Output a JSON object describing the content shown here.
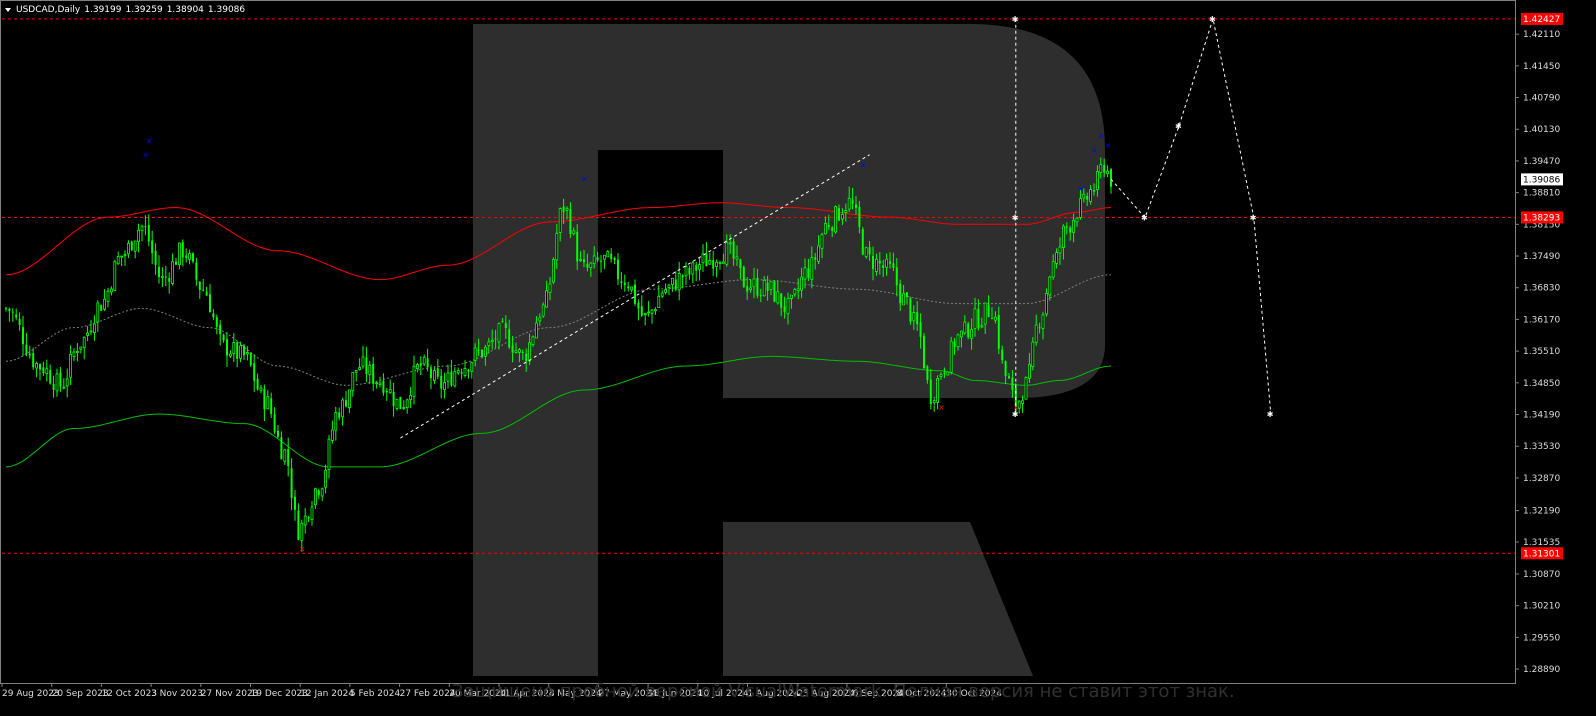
{
  "header": {
    "symbol": "USDCAD,Daily",
    "open": "1.39199",
    "high": "1.39259",
    "low": "1.38904",
    "close": "1.39086"
  },
  "watermark_text": "Защищено пробной версией VisualWatermark. Полная версия не ставит этот знак.",
  "colors": {
    "background": "#000000",
    "candle": "#00ff00",
    "ma_upper": "#ff0000",
    "ma_lower": "#00c000",
    "ma_mid": "#808080",
    "level_line": "#ff0000",
    "forecast": "#ffffff",
    "fractal_up": "#0000ff",
    "fractal_down": "#ff0000",
    "price_tag": "#ff0000",
    "current_tag": "#ffffff",
    "watermark": "#2e2e2e"
  },
  "chart_data": {
    "type": "candlestick",
    "symbol": "USDCAD",
    "timeframe": "Daily",
    "ylim": [
      1.286,
      1.428
    ],
    "price_ticks": [
      "1.42110",
      "1.41450",
      "1.40790",
      "1.40130",
      "1.39470",
      "1.38810",
      "1.38150",
      "1.37490",
      "1.36830",
      "1.36170",
      "1.35510",
      "1.34850",
      "1.34190",
      "1.33530",
      "1.32870",
      "1.32190",
      "1.31535",
      "1.30870",
      "1.30210",
      "1.29550",
      "1.28890"
    ],
    "date_ticks": [
      "29 Aug 2023",
      "20 Sep 2023",
      "12 Oct 2023",
      "3 Nov 2023",
      "27 Nov 2023",
      "19 Dec 2023",
      "12 Jan 2024",
      "5 Feb 2024",
      "27 Feb 2024",
      "20 Mar 2024",
      "11 Apr 2024",
      "3 May 2024",
      "27 May 2024",
      "18 Jun 2024",
      "10 Jul 2024",
      "1 Aug 2024",
      "23 Aug 2024",
      "16 Sep 2024",
      "8 Oct 2024",
      "30 Oct 2024"
    ],
    "price_tags": [
      {
        "label": "1.42427",
        "value": 1.42427,
        "kind": "level"
      },
      {
        "label": "1.39086",
        "value": 1.39086,
        "kind": "current"
      },
      {
        "label": "1.38293",
        "value": 1.38293,
        "kind": "level"
      },
      {
        "label": "1.31301",
        "value": 1.31301,
        "kind": "level"
      }
    ],
    "levels": [
      1.42427,
      1.38293,
      1.31301
    ],
    "close_anchors": [
      [
        0,
        1.364
      ],
      [
        10,
        1.352
      ],
      [
        16,
        1.348
      ],
      [
        22,
        1.357
      ],
      [
        28,
        1.365
      ],
      [
        34,
        1.375
      ],
      [
        40,
        1.381
      ],
      [
        46,
        1.37
      ],
      [
        52,
        1.376
      ],
      [
        58,
        1.368
      ],
      [
        64,
        1.356
      ],
      [
        70,
        1.354
      ],
      [
        76,
        1.345
      ],
      [
        82,
        1.334
      ],
      [
        86,
        1.318
      ],
      [
        92,
        1.327
      ],
      [
        98,
        1.343
      ],
      [
        104,
        1.352
      ],
      [
        110,
        1.349
      ],
      [
        116,
        1.344
      ],
      [
        122,
        1.352
      ],
      [
        128,
        1.348
      ],
      [
        134,
        1.352
      ],
      [
        140,
        1.355
      ],
      [
        146,
        1.359
      ],
      [
        152,
        1.354
      ],
      [
        158,
        1.364
      ],
      [
        164,
        1.385
      ],
      [
        170,
        1.372
      ],
      [
        176,
        1.374
      ],
      [
        182,
        1.37
      ],
      [
        188,
        1.362
      ],
      [
        194,
        1.368
      ],
      [
        200,
        1.371
      ],
      [
        206,
        1.374
      ],
      [
        212,
        1.376
      ],
      [
        218,
        1.369
      ],
      [
        224,
        1.368
      ],
      [
        230,
        1.364
      ],
      [
        236,
        1.372
      ],
      [
        242,
        1.382
      ],
      [
        248,
        1.386
      ],
      [
        254,
        1.374
      ],
      [
        260,
        1.372
      ],
      [
        264,
        1.366
      ],
      [
        268,
        1.36
      ],
      [
        272,
        1.346
      ],
      [
        276,
        1.352
      ],
      [
        280,
        1.358
      ],
      [
        286,
        1.362
      ],
      [
        290,
        1.364
      ],
      [
        294,
        1.35
      ],
      [
        297,
        1.344
      ],
      [
        300,
        1.348
      ],
      [
        304,
        1.362
      ],
      [
        308,
        1.373
      ],
      [
        312,
        1.381
      ],
      [
        316,
        1.385
      ],
      [
        320,
        1.389
      ],
      [
        323,
        1.394
      ],
      [
        325,
        1.3909
      ]
    ],
    "ma_red": [
      [
        0,
        1.371
      ],
      [
        30,
        1.383
      ],
      [
        50,
        1.385
      ],
      [
        80,
        1.376
      ],
      [
        110,
        1.37
      ],
      [
        130,
        1.373
      ],
      [
        160,
        1.382
      ],
      [
        190,
        1.385
      ],
      [
        210,
        1.386
      ],
      [
        230,
        1.385
      ],
      [
        260,
        1.383
      ],
      [
        280,
        1.3815
      ],
      [
        300,
        1.3815
      ],
      [
        315,
        1.384
      ],
      [
        325,
        1.385
      ]
    ],
    "ma_green": [
      [
        0,
        1.331
      ],
      [
        20,
        1.339
      ],
      [
        45,
        1.342
      ],
      [
        70,
        1.34
      ],
      [
        95,
        1.331
      ],
      [
        110,
        1.331
      ],
      [
        140,
        1.338
      ],
      [
        170,
        1.347
      ],
      [
        200,
        1.352
      ],
      [
        225,
        1.354
      ],
      [
        250,
        1.353
      ],
      [
        275,
        1.351
      ],
      [
        285,
        1.349
      ],
      [
        300,
        1.348
      ],
      [
        310,
        1.349
      ],
      [
        325,
        1.352
      ]
    ],
    "ma_mid": [
      [
        0,
        1.353
      ],
      [
        20,
        1.36
      ],
      [
        40,
        1.364
      ],
      [
        60,
        1.36
      ],
      [
        80,
        1.352
      ],
      [
        100,
        1.348
      ],
      [
        130,
        1.352
      ],
      [
        160,
        1.36
      ],
      [
        190,
        1.368
      ],
      [
        220,
        1.37
      ],
      [
        250,
        1.368
      ],
      [
        280,
        1.365
      ],
      [
        300,
        1.365
      ],
      [
        325,
        1.371
      ]
    ],
    "trendline": [
      [
        116,
        1.337
      ],
      [
        254,
        1.396
      ]
    ],
    "forecast_path": [
      [
        325,
        1.3909
      ],
      [
        335,
        1.3829
      ],
      [
        345,
        1.402
      ],
      [
        355,
        1.4243
      ],
      [
        367,
        1.3829
      ],
      [
        372,
        1.342
      ]
    ],
    "vline": {
      "x": 297,
      "from": 1.4243,
      "to": 1.342
    },
    "fractals_up": [
      [
        41,
        1.396
      ],
      [
        42,
        1.399
      ],
      [
        170,
        1.391
      ],
      [
        252,
        1.394
      ],
      [
        316,
        1.389
      ],
      [
        320,
        1.397
      ],
      [
        322,
        1.4
      ],
      [
        324,
        1.398
      ]
    ],
    "fractals_down": [
      [
        87,
        1.314
      ],
      [
        275,
        1.3435
      ],
      [
        297,
        1.3435
      ]
    ]
  }
}
